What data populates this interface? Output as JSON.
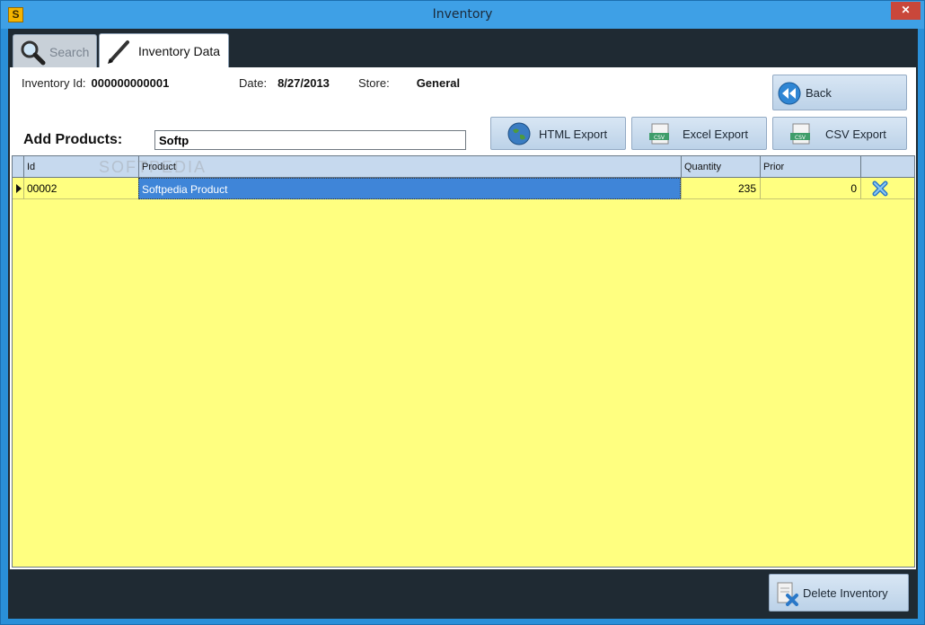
{
  "window": {
    "title": "Inventory",
    "app_icon": "S",
    "close": "✕"
  },
  "tabs": [
    {
      "label": "Search",
      "icon": "magnifier-icon"
    },
    {
      "label": "Inventory Data",
      "icon": "pencil-icon"
    }
  ],
  "info": {
    "inventory_id_label": "Inventory Id:",
    "inventory_id_value": "000000000001",
    "date_label": "Date:",
    "date_value": "8/27/2013",
    "store_label": "Store:",
    "store_value": "General"
  },
  "add_products": {
    "label": "Add Products:",
    "value": "Softp"
  },
  "buttons": {
    "back": "Back",
    "html_export": "HTML Export",
    "excel_export": "Excel Export",
    "csv_export": "CSV Export",
    "delete_inventory": "Delete Inventory"
  },
  "grid": {
    "columns": [
      "Id",
      "Product",
      "Quantity",
      "Prior",
      ""
    ],
    "rows": [
      {
        "id": "00002",
        "product": "Softpedia Product",
        "quantity": "235",
        "prior": "0"
      }
    ]
  },
  "watermark": "SOFTPEDIA",
  "colors": {
    "grid_bg": "#ffff80",
    "header_bg": "#c6d9ee",
    "selection": "#3f85d8",
    "titlebar": "#3ea0e6"
  }
}
